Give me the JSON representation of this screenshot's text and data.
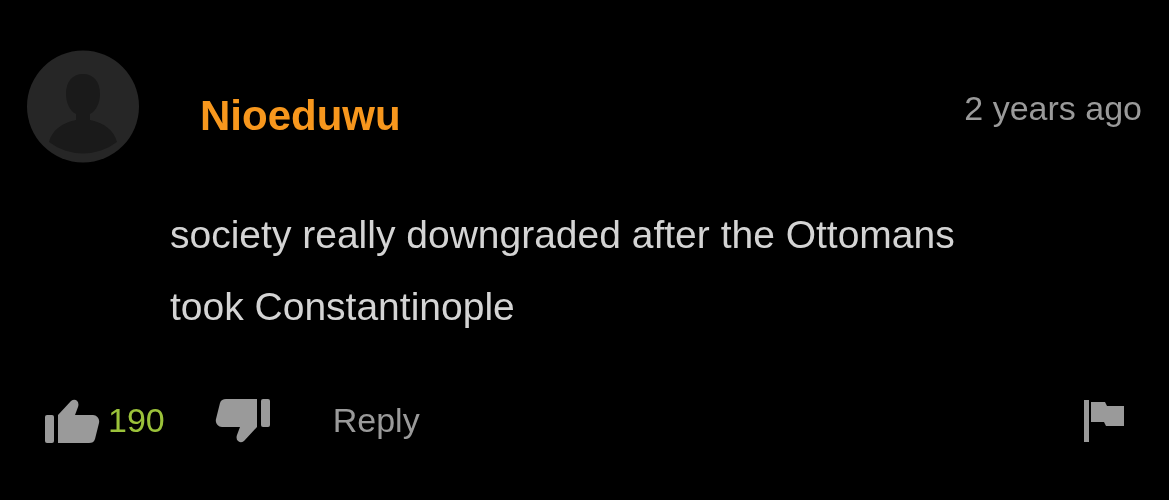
{
  "comment": {
    "username": "Nioeduwu",
    "time": "2 years ago",
    "text": "society really downgraded after the Ottomans took Constantinople",
    "likes": "190",
    "reply": "Reply"
  }
}
